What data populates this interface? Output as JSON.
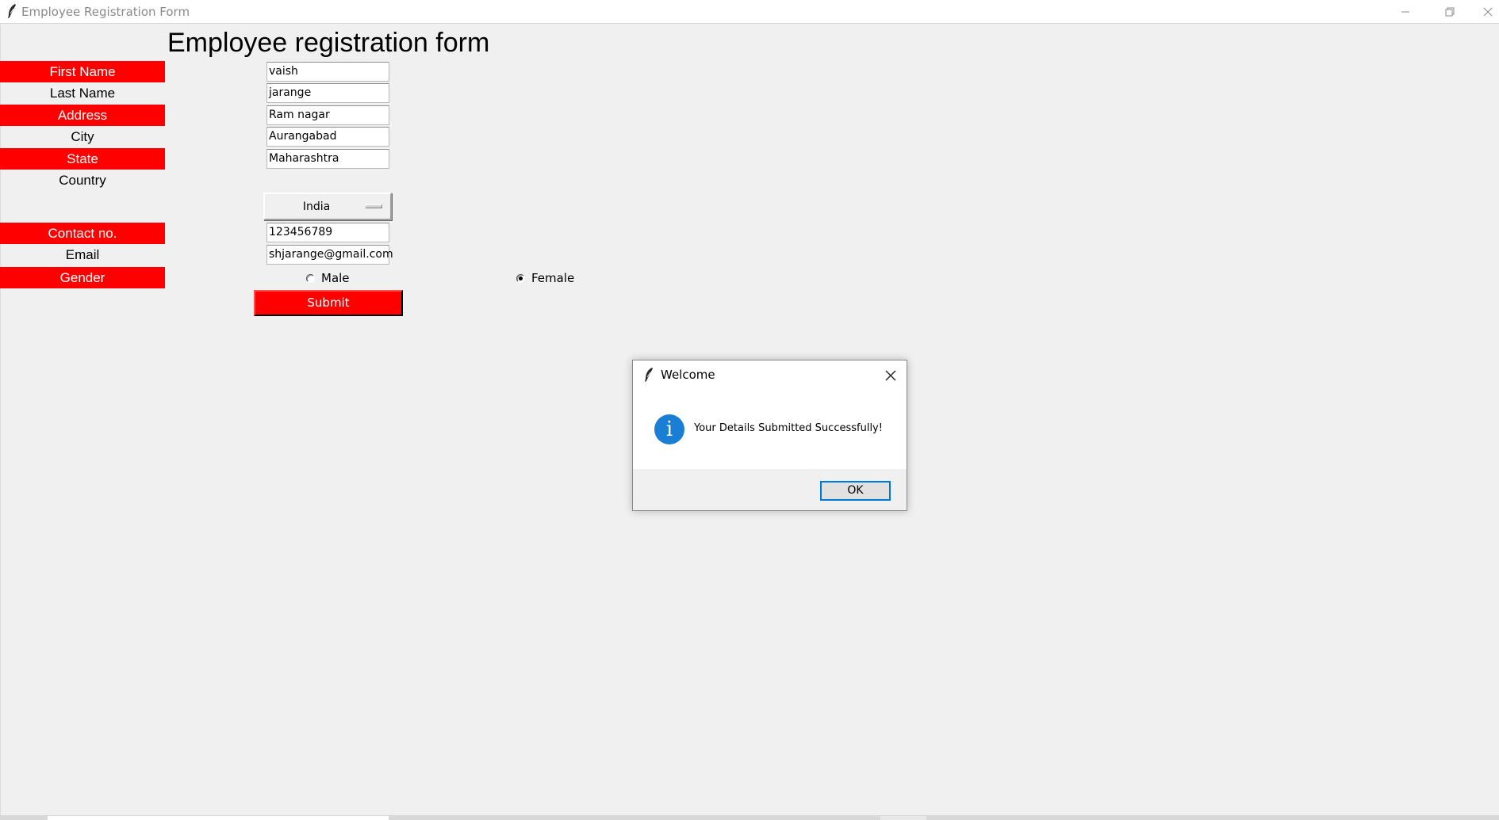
{
  "window": {
    "title": "Employee Registration Form",
    "minimize_icon": "minimize-icon",
    "maximize_icon": "restore-icon",
    "close_icon": "close-icon"
  },
  "form": {
    "heading": "Employee registration form",
    "labels": {
      "first_name": "First Name",
      "last_name": "Last Name",
      "address": "Address",
      "city": "City",
      "state": "State",
      "country": "Country",
      "contact": "Contact no.",
      "email": "Email",
      "gender": "Gender"
    },
    "values": {
      "first_name": "vaish",
      "last_name": "jarange",
      "address": "Ram nagar",
      "city": "Aurangabad",
      "state": "Maharashtra",
      "country": "India",
      "contact": "123456789",
      "email": "shjarange@gmail.com"
    },
    "gender_options": {
      "male": "Male",
      "female": "Female",
      "selected": "Female"
    },
    "submit_label": "Submit",
    "colors": {
      "label_red": "#ff0000",
      "submit_red": "#ff0000"
    }
  },
  "dialog": {
    "title": "Welcome",
    "icon": "info-icon",
    "message": "Your Details Submitted Successfully!",
    "ok_label": "OK",
    "close_icon": "close-icon"
  }
}
